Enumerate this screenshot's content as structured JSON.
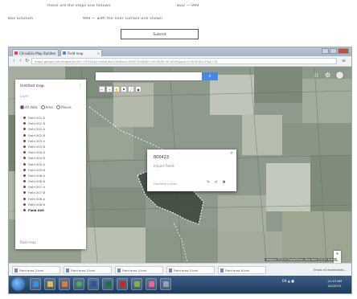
{
  "document": {
    "line1_left": "These are the steps one follows:",
    "line1_right": "BLD — 999",
    "line2_left": "Box Solution",
    "line2_right": "999 — with the near surface one shown",
    "submit_label": "Submit"
  },
  "browser": {
    "tabs": [
      {
        "label": "ChinaEdu Map Builder"
      },
      {
        "label": "Field map"
      }
    ],
    "url": "maps.google.com/maps/ms?ie=UTF8&hl=en&msa=0&msid=0000.0000&ll=00.0000,00.0000&spn=0.0000&t=h&z=15"
  },
  "map_ui": {
    "search_placeholder": "",
    "search_icon": "search-icon",
    "tools": [
      "←",
      "→",
      "✋",
      "⚑",
      "╱",
      "▣"
    ],
    "zoom_in": "+",
    "zoom_out": "−",
    "attribution": "Imagery ©2015 DigitalGlobe, Map data ©2015  Terms"
  },
  "panel": {
    "title": "Untitled map",
    "subtitle": "Layer",
    "radio_labels": [
      "All data",
      "Area",
      "Places"
    ],
    "items": [
      "Field 001 A",
      "Field 001 B",
      "Field 002 A",
      "Field 002 B",
      "Field 003 A",
      "Field 003 B",
      "Field 004 A",
      "Field 004 B",
      "Field 005 A",
      "Field 005 B",
      "Field 006 A",
      "Field 006 B",
      "Field 007 A",
      "Field 007 B",
      "Field 008 A",
      "Field 008 B",
      "Field 009"
    ],
    "footer": "Base map"
  },
  "popup": {
    "title": "800423",
    "subtitle": "Import Fields",
    "meta": "Geometry data",
    "close": "×",
    "icons": "✎ ✐ ✖"
  },
  "downloads": {
    "items": [
      "Field area 2.kml",
      "Field area 3.kml",
      "Field area 4.kml",
      "Field area 5.kml",
      "Field area 6.kml"
    ],
    "show_all": "Show all downloads..."
  },
  "taskbar": {
    "tray": "EN  ▲  ■",
    "time": "11:43 AM",
    "date": "4/2/2015"
  },
  "colors": {
    "accent": "#4a86e8",
    "taskbar": "#1e3a5c"
  }
}
